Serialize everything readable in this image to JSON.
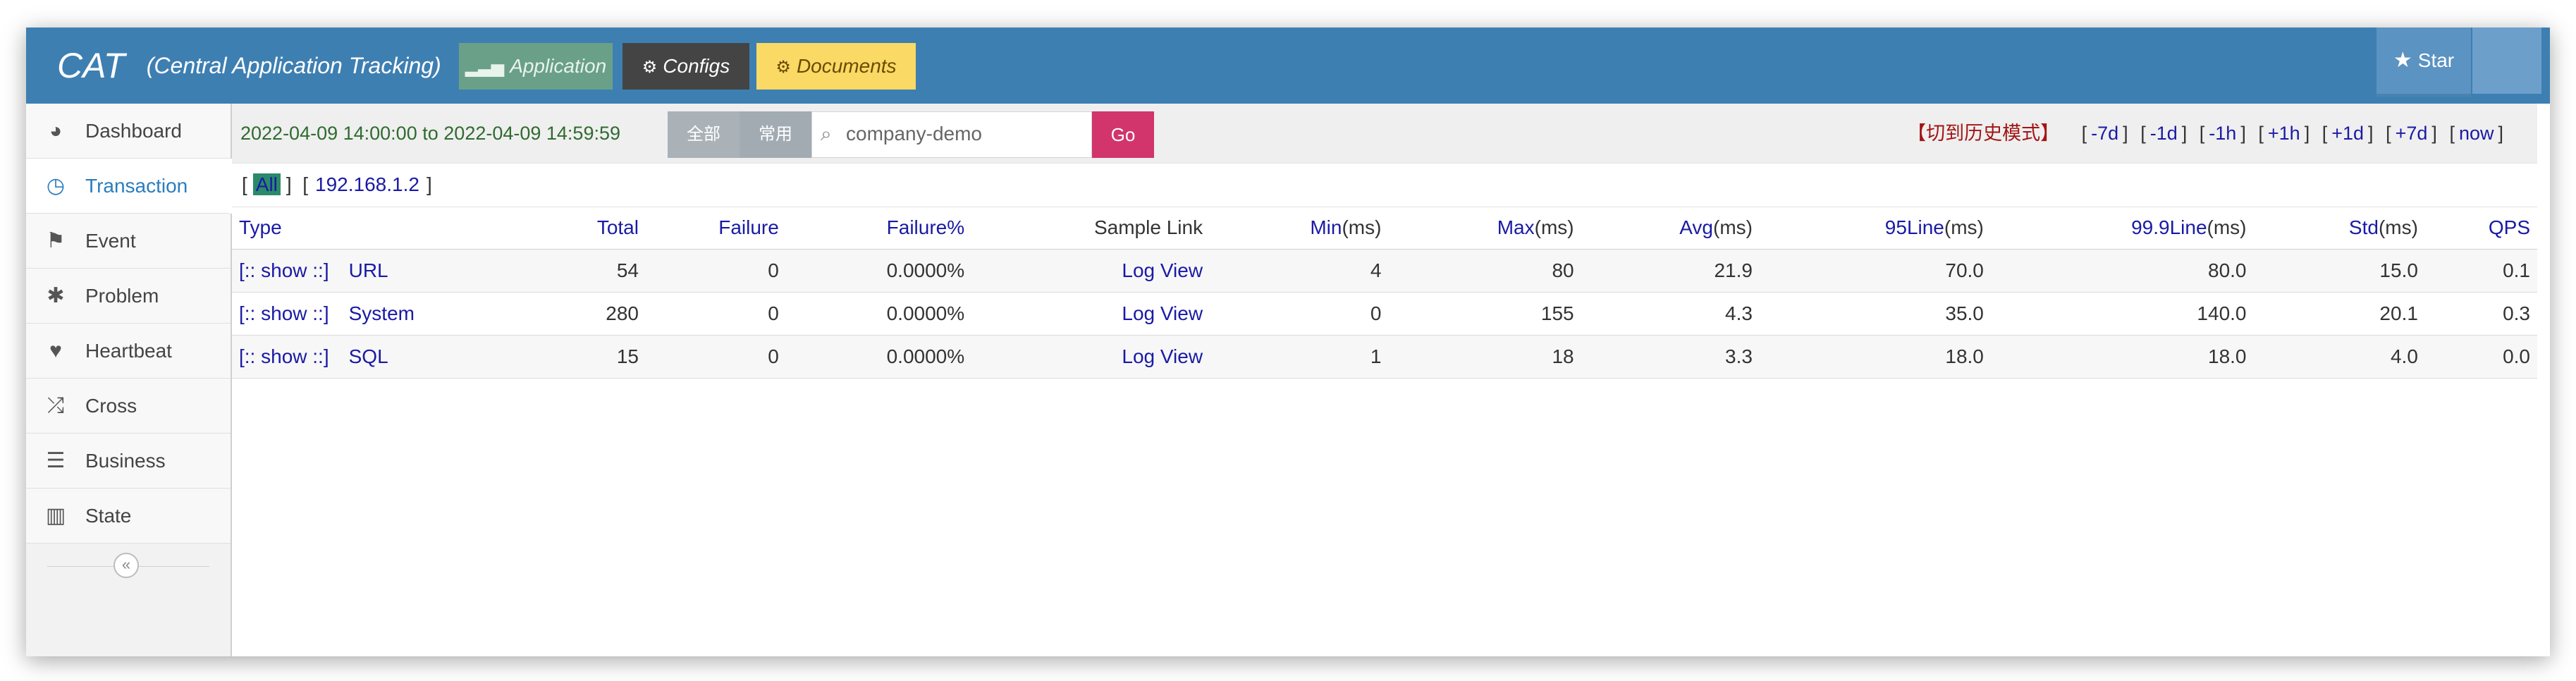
{
  "header": {
    "brand": "CAT",
    "brand_subtitle": "(Central Application Tracking)",
    "nav": [
      {
        "label": "Application",
        "icon": "signal-bars-icon"
      },
      {
        "label": "Configs",
        "icon": "cogs-icon"
      },
      {
        "label": "Documents",
        "icon": "cogs-icon"
      }
    ],
    "star_label": "Star",
    "colors": {
      "navbar": "#3e7fb2",
      "application": "#6aa088",
      "configs": "#444444",
      "documents": "#fad964"
    }
  },
  "sidebar": {
    "items": [
      {
        "label": "Dashboard",
        "icon": "tachometer-icon",
        "active": false
      },
      {
        "label": "Transaction",
        "icon": "clock-icon",
        "active": true
      },
      {
        "label": "Event",
        "icon": "flag-icon",
        "active": false
      },
      {
        "label": "Problem",
        "icon": "bug-icon",
        "active": false
      },
      {
        "label": "Heartbeat",
        "icon": "heart-icon",
        "active": false
      },
      {
        "label": "Cross",
        "icon": "random-icon",
        "active": false
      },
      {
        "label": "Business",
        "icon": "list-icon",
        "active": false
      },
      {
        "label": "State",
        "icon": "bar-chart-icon",
        "active": false
      }
    ],
    "collapse_icon": "double-chevron-left-icon"
  },
  "toolbar": {
    "date_from": "2022-04-09 14:00:00",
    "date_to_sep": "to",
    "date_to": "2022-04-09 14:59:59",
    "segments": [
      "全部",
      "常用"
    ],
    "search_value": "company-demo",
    "search_icon": "search-icon",
    "go_label": "Go",
    "history_toggle": "【切到历史模式】",
    "history_links": [
      "-7d",
      "-1d",
      "-1h",
      "+1h",
      "+1d",
      "+7d",
      "now"
    ]
  },
  "ip_filter": {
    "all_label": "All",
    "ip": "192.168.1.2"
  },
  "table": {
    "headers": {
      "type": "Type",
      "total": "Total",
      "failure": "Failure",
      "failure_pct": "Failure%",
      "sample": "Sample Link",
      "min": "Min",
      "max": "Max",
      "avg": "Avg",
      "line95": "95Line",
      "line999": "99.9Line",
      "std": "Std",
      "qps": "QPS",
      "unit": "(ms)"
    },
    "rows": [
      {
        "show": "[:: show ::]",
        "type": "URL",
        "total": "54",
        "failure": "0",
        "failure_pct": "0.0000%",
        "sample": "Log View",
        "min": "4",
        "max": "80",
        "avg": "21.9",
        "line95": "70.0",
        "line999": "80.0",
        "std": "15.0",
        "qps": "0.1"
      },
      {
        "show": "[:: show ::]",
        "type": "System",
        "total": "280",
        "failure": "0",
        "failure_pct": "0.0000%",
        "sample": "Log View",
        "min": "0",
        "max": "155",
        "avg": "4.3",
        "line95": "35.0",
        "line999": "140.0",
        "std": "20.1",
        "qps": "0.3"
      },
      {
        "show": "[:: show ::]",
        "type": "SQL",
        "total": "15",
        "failure": "0",
        "failure_pct": "0.0000%",
        "sample": "Log View",
        "min": "1",
        "max": "18",
        "avg": "3.3",
        "line95": "18.0",
        "line999": "18.0",
        "std": "4.0",
        "qps": "0.0"
      }
    ]
  }
}
